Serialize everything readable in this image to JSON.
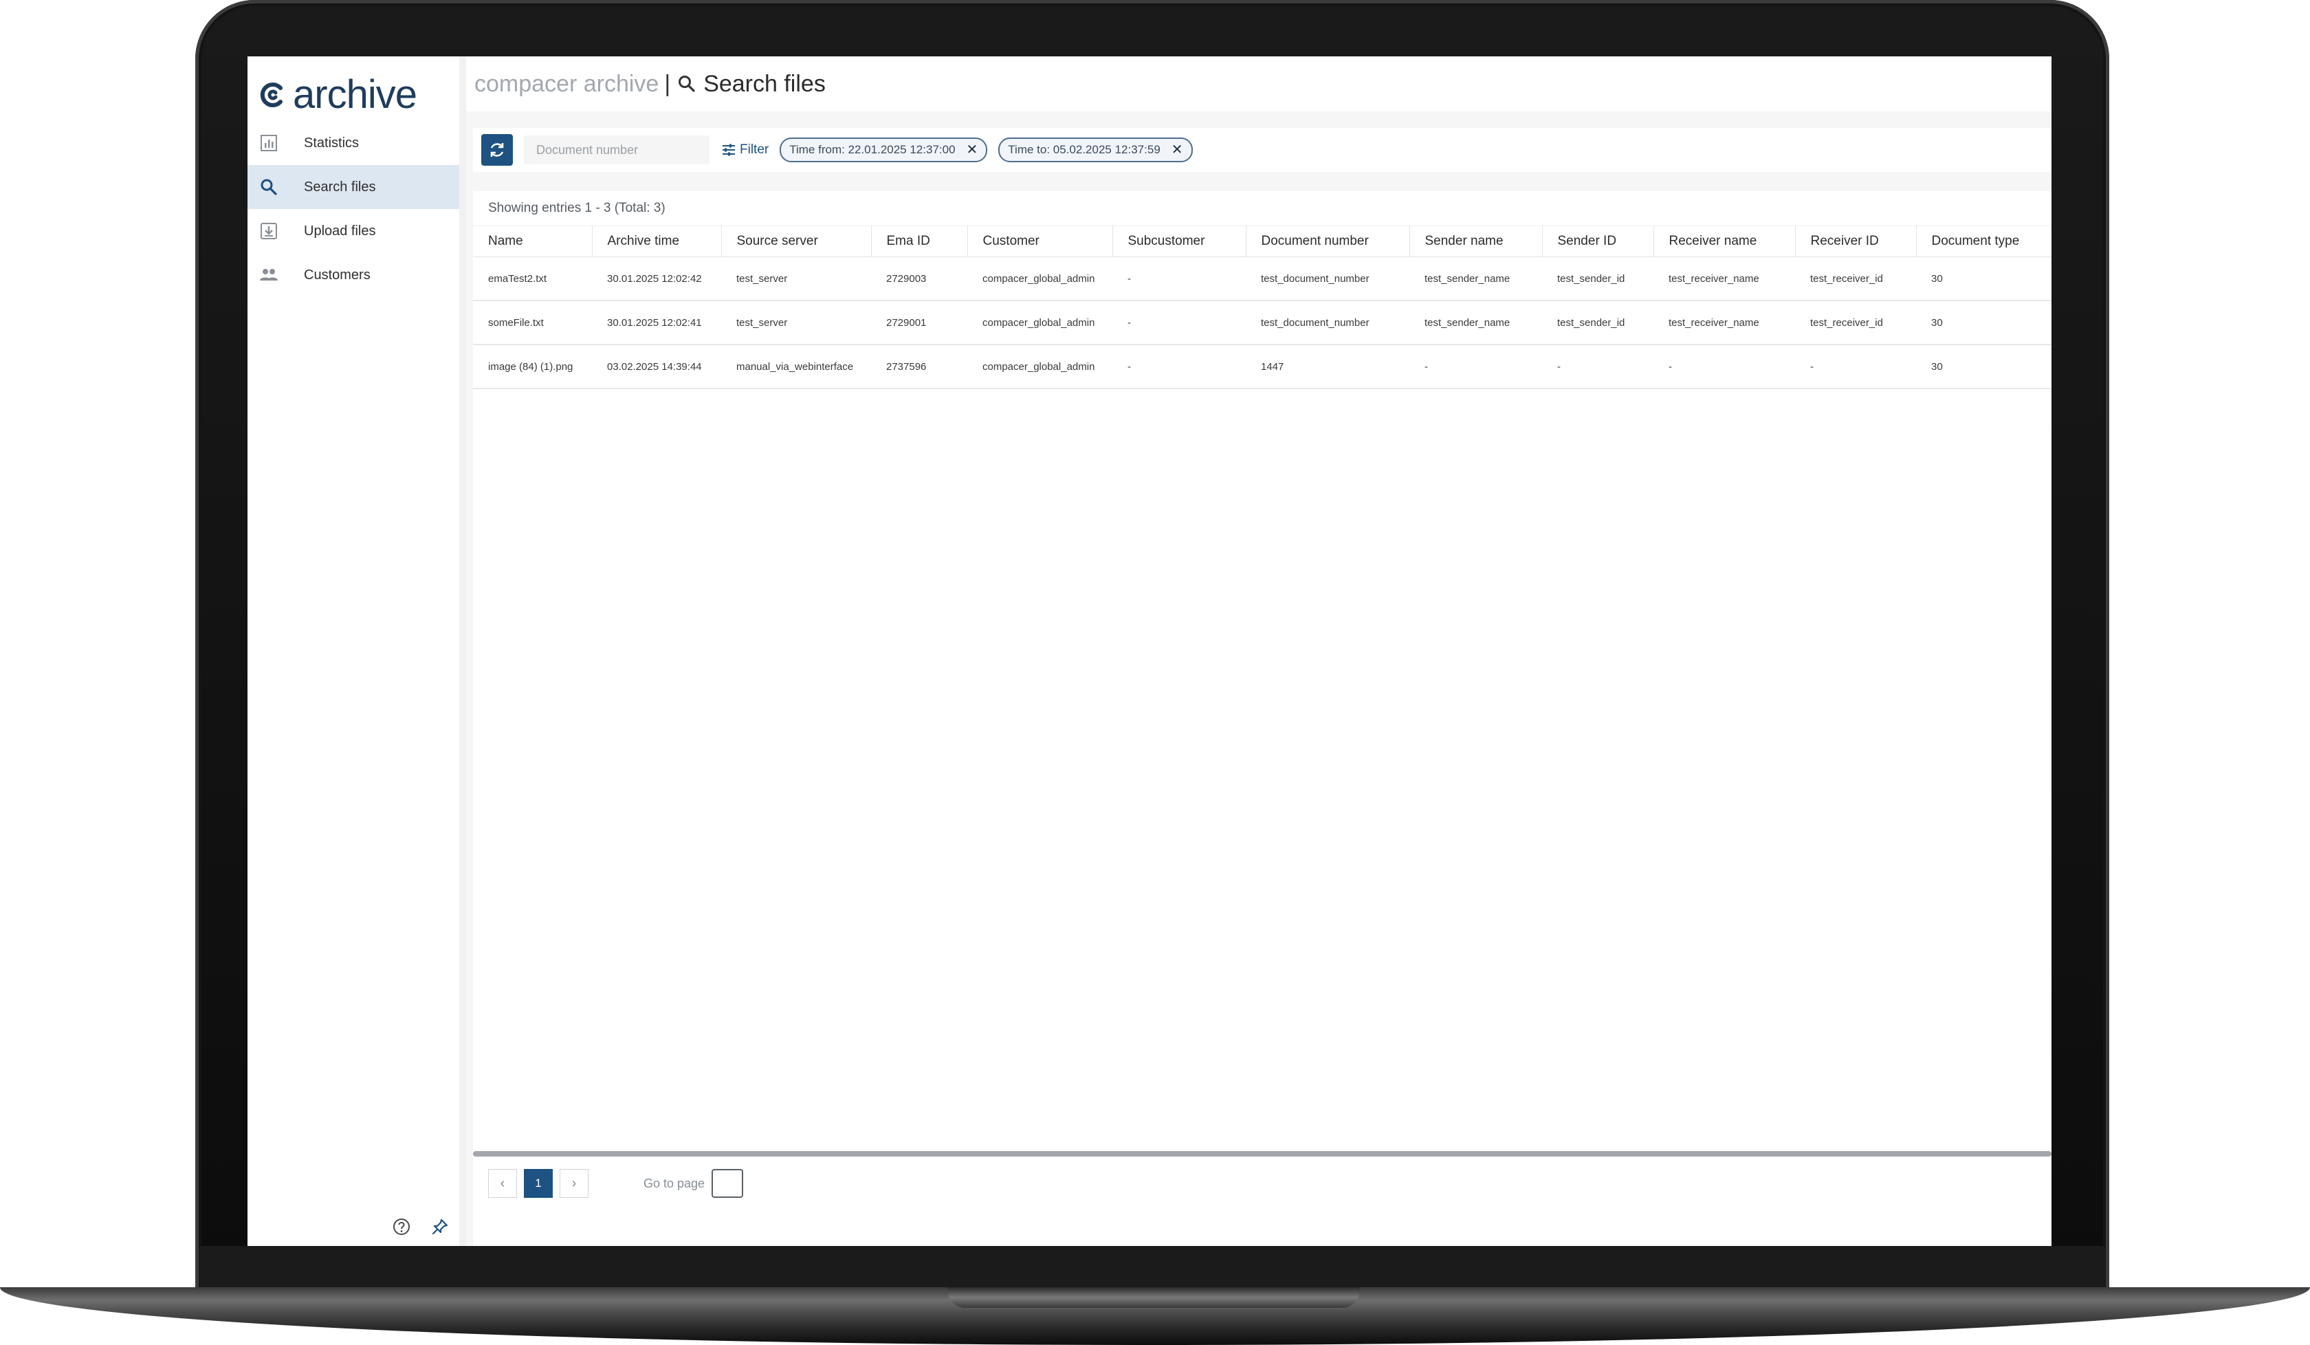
{
  "app": {
    "logo_text": "archive",
    "breadcrumb_app": "compacer archive",
    "breadcrumb_separator": "|",
    "page_title": "Search files"
  },
  "sidebar": {
    "items": [
      {
        "label": "Statistics",
        "icon": "bar-chart-icon"
      },
      {
        "label": "Search files",
        "icon": "search-icon",
        "active": true
      },
      {
        "label": "Upload files",
        "icon": "download-tray-icon"
      },
      {
        "label": "Customers",
        "icon": "people-icon"
      }
    ],
    "footer_icons": [
      "help-circle-icon",
      "pin-icon"
    ]
  },
  "toolbar": {
    "search_placeholder": "Document number",
    "filter_label": "Filter",
    "chips": [
      {
        "label": "Time from: 22.01.2025 12:37:00"
      },
      {
        "label": "Time to: 05.02.2025 12:37:59"
      }
    ],
    "chip_remove_glyph": "✕"
  },
  "results": {
    "summary": "Showing entries 1 - 3 (Total: 3)",
    "columns": [
      "Name",
      "Archive time",
      "Source server",
      "Ema ID",
      "Customer",
      "Subcustomer",
      "Document number",
      "Sender name",
      "Sender ID",
      "Receiver name",
      "Receiver ID",
      "Document type"
    ],
    "rows": [
      [
        "emaTest2.txt",
        "30.01.2025 12:02:42",
        "test_server",
        "2729003",
        "compacer_global_admin",
        "-",
        "test_document_number",
        "test_sender_name",
        "test_sender_id",
        "test_receiver_name",
        "test_receiver_id",
        "30"
      ],
      [
        "someFile.txt",
        "30.01.2025 12:02:41",
        "test_server",
        "2729001",
        "compacer_global_admin",
        "-",
        "test_document_number",
        "test_sender_name",
        "test_sender_id",
        "test_receiver_name",
        "test_receiver_id",
        "30"
      ],
      [
        "image (84) (1).png",
        "03.02.2025 14:39:44",
        "manual_via_webinterface",
        "2737596",
        "compacer_global_admin",
        "-",
        "1447",
        "-",
        "-",
        "-",
        "-",
        "30"
      ]
    ]
  },
  "pagination": {
    "prev_glyph": "‹",
    "next_glyph": "›",
    "current_page": "1",
    "goto_label": "Go to page"
  },
  "colors": {
    "brand": "#1d5282",
    "active_nav_bg": "#dde7f1",
    "logo_text": "#1f3c5c"
  }
}
